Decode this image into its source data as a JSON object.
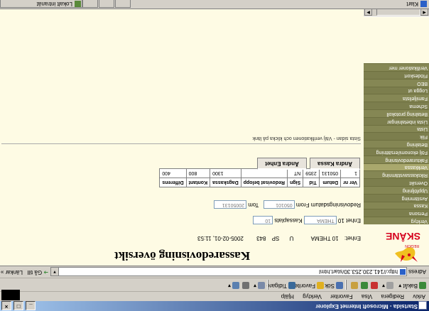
{
  "window": {
    "title": "Startsida - Microsoft Internet Explorer",
    "controls": [
      "_",
      "□",
      "×"
    ]
  },
  "menubar": {
    "items": [
      "Arkiv",
      "Redigera",
      "Visa",
      "Favoriter",
      "Verktyg",
      "Hjälp"
    ]
  },
  "toolbar": {
    "back": "Bakåt",
    "search": "Sök",
    "favorites": "Favoriter",
    "history": "Tidigare"
  },
  "address": {
    "label": "Adress",
    "url": "http://141.230.253.30/start.html",
    "go": "Gå till",
    "links": "Länkar »"
  },
  "page": {
    "title": "Kassaredovisning översikt",
    "logo_text": "SKÅNE",
    "logo_sub": "REGION",
    "info": {
      "enhet_label": "Enhet:",
      "enhet_value": "10 THEMA",
      "u": "U",
      "sp_label": "SP",
      "sp_value": "843",
      "datetime": "2005-02-01, 11:53"
    },
    "filters": {
      "enhet_label": "Enhet 10",
      "enhet_placeholder": "THEMA",
      "kassaplats_label": "Kassaplats",
      "kassaplats_value": "10",
      "period_label": "Redovisningsdatum From",
      "from_value": "050101",
      "tom_label": "Tom",
      "tom_value": "20050131"
    },
    "table": {
      "headers": [
        "Ver nr",
        "Datum",
        "Tid",
        "Sign",
        "Redovisat belopp",
        "Dagskassa",
        "Kontant",
        "Differens"
      ],
      "rows": [
        [
          "1",
          "050131",
          "2359",
          "NT",
          "",
          "1300",
          "800",
          "400"
        ]
      ]
    },
    "tabs": [
      "Ändra Kassa",
      "Ändra Enhet"
    ],
    "hint": "Sista sidan - Välj verifikationen och klicka på länk"
  },
  "sidebar": {
    "menu": [
      "Verktyg",
      "Persona",
      "Kassa",
      "Avstämning",
      "Uppföljning",
      "Översikt",
      "Rikskassavstämning",
      "Verkkassa",
      "Fakturaredovisning",
      "Följ ekonomi/ersättning",
      "Betalning",
      "Flik",
      "Lista",
      "Lista inbetalningar",
      "Betalning protokoll",
      "Schema",
      "Familjelista",
      "Logga ut",
      "BEO",
      "Flödeskort",
      "Verifikationer mer"
    ]
  },
  "status": {
    "left": "Klart",
    "right": "Lokalt intranät"
  },
  "colors": {
    "sidebar_menu": "#858754",
    "content_bg": "#fefbe4",
    "logo_red": "#d5001c",
    "titlebar": "#0a246a"
  }
}
